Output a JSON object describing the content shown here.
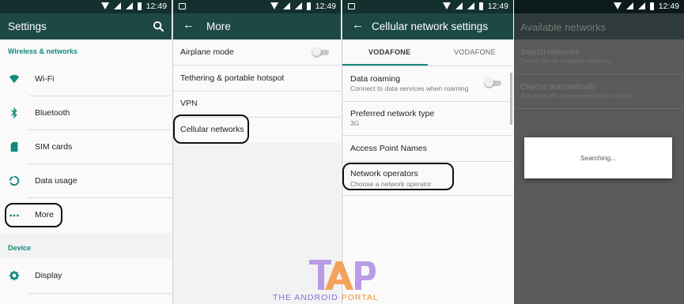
{
  "status_time": "12:49",
  "colors": {
    "appbar": "#1d4846",
    "statusbar": "#13302f",
    "accent": "#13897b",
    "highlight_box": "#111111",
    "logo_tap": "#b99be6",
    "logo_a": "#f3a25a",
    "logo_text": "#8a6fd8",
    "logo_text2": "#e8903c"
  },
  "settings": {
    "title": "Settings",
    "section_wireless": "Wireless & networks",
    "items": [
      {
        "label": "Wi-Fi",
        "icon": "wifi-icon"
      },
      {
        "label": "Bluetooth",
        "icon": "bluetooth-icon"
      },
      {
        "label": "SIM cards",
        "icon": "sim-card-icon"
      },
      {
        "label": "Data usage",
        "icon": "data-usage-icon"
      },
      {
        "label": "More",
        "icon": "more-dots-icon"
      }
    ],
    "section_device": "Device",
    "display_label": "Display",
    "display_icon": "brightness-icon"
  },
  "more": {
    "title": "More",
    "items": [
      {
        "label": "Airplane mode",
        "toggle": "off"
      },
      {
        "label": "Tethering & portable hotspot"
      },
      {
        "label": "VPN"
      },
      {
        "label": "Cellular networks"
      }
    ]
  },
  "cellular": {
    "title": "Cellular network settings",
    "tabs": [
      "VODAFONE",
      "VODAFONE"
    ],
    "active_tab": 0,
    "items": [
      {
        "label": "Data roaming",
        "sub": "Connect to data services when roaming",
        "toggle": "off"
      },
      {
        "label": "Preferred network type",
        "sub": "3G"
      },
      {
        "label": "Access Point Names"
      },
      {
        "label": "Network operators",
        "sub": "Choose a network operator"
      }
    ]
  },
  "available": {
    "title": "Available networks",
    "items": [
      {
        "label": "Search networks",
        "sub": "Search for all available networks"
      },
      {
        "label": "Choose automatically",
        "sub": "Automatically choose preferred network"
      }
    ],
    "dialog_text": "Searching..."
  },
  "watermark": {
    "logo": "TAP",
    "tagline_part1": "THE ANDROID ",
    "tagline_part2": "PORTAL"
  }
}
